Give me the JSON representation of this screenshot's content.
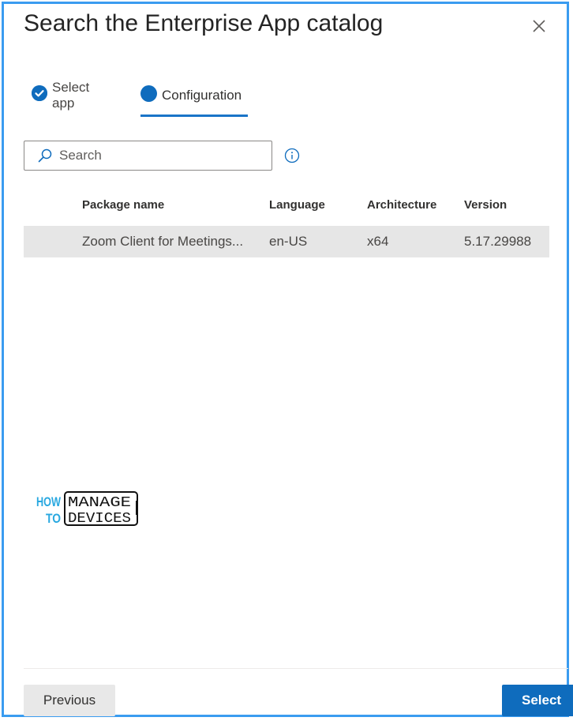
{
  "dialog": {
    "title": "Search the Enterprise App catalog",
    "close_icon": "close-icon"
  },
  "steps": [
    {
      "label": "Select app",
      "state": "completed",
      "icon": "checkmark-circle-icon"
    },
    {
      "label": "Configuration",
      "state": "current",
      "icon": "filled-circle-icon"
    }
  ],
  "search": {
    "placeholder": "Search",
    "value": "",
    "icon": "search-icon",
    "info_icon": "info-icon"
  },
  "table": {
    "columns": [
      "Package name",
      "Language",
      "Architecture",
      "Version"
    ],
    "rows": [
      {
        "package_name": "Zoom Client for Meetings...",
        "language": "en-US",
        "architecture": "x64",
        "version": "5.17.29988"
      }
    ]
  },
  "watermark": {
    "line1_left": "HOW",
    "line2_left": "TO",
    "line1_right": "MANAGE",
    "line2_right": "DEVICES"
  },
  "footer": {
    "previous_label": "Previous",
    "select_label": "Select"
  },
  "colors": {
    "accent": "#0f6cbd",
    "frame_border": "#3a9cf0",
    "row_selected_bg": "#e6e6e6",
    "logo_blue": "#29a8e0"
  }
}
